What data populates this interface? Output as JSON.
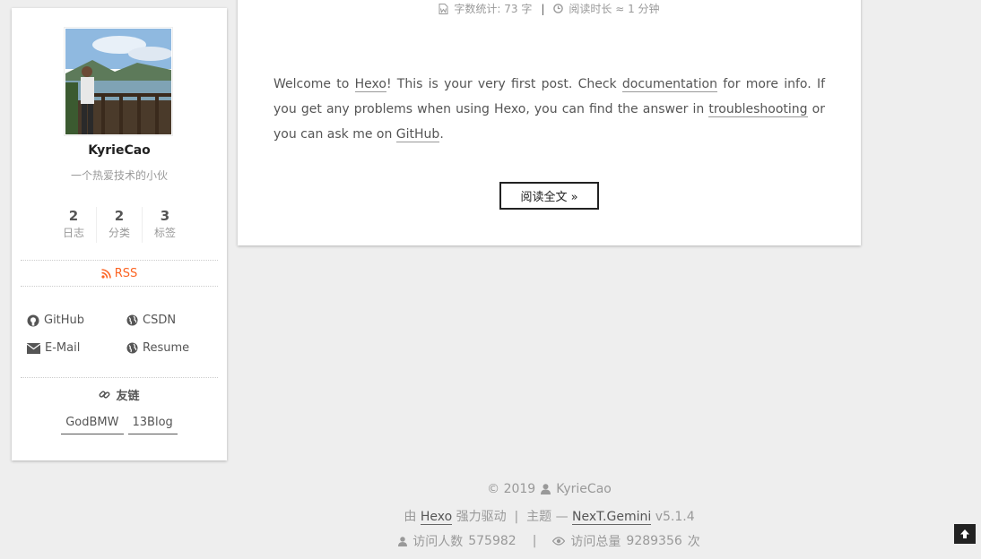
{
  "sidebar": {
    "author": "KyrieCao",
    "description": "一个热爱技术的小伙",
    "stats": [
      {
        "count": "2",
        "label": "日志"
      },
      {
        "count": "2",
        "label": "分类"
      },
      {
        "count": "3",
        "label": "标签"
      }
    ],
    "rss_label": "RSS",
    "links": [
      {
        "label": "GitHub",
        "icon": "github-icon"
      },
      {
        "label": "CSDN",
        "icon": "globe-icon"
      },
      {
        "label": "E-Mail",
        "icon": "envelope-icon"
      },
      {
        "label": "Resume",
        "icon": "globe-icon"
      }
    ],
    "friends_title": "友链",
    "friends": [
      "GodBMW",
      "13Blog"
    ]
  },
  "post": {
    "word_count": "字数统计: 73 字",
    "meta_separator": "|",
    "read_time": "阅读时长 ≈ 1 分钟",
    "text": {
      "p1": "Welcome to ",
      "hexo": "Hexo",
      "p2": "! This is your very first post. Check ",
      "documentation": "documentation",
      "p3": " for more info. If you get any problems when using Hexo, you can find the answer in ",
      "troubleshooting": "troubleshooting",
      "p4": " or you can ask me on ",
      "github": "GitHub",
      "p5": "."
    },
    "read_more": "阅读全文 »"
  },
  "footer": {
    "copyright": "© 2019",
    "author": "KyrieCao",
    "powered_prefix": "由 ",
    "hexo": "Hexo",
    "powered_suffix": " 强力驱动  |  主题 — ",
    "theme": "NexT.Gemini",
    "version": " v5.1.4",
    "visitors_label": "访问人数",
    "visitors": "575982",
    "separator": "|",
    "views_label": "访问总量",
    "views": "9289356",
    "views_unit": "次"
  },
  "colors": {
    "accent_rss": "#fc6423",
    "background": "#eeeeee"
  }
}
